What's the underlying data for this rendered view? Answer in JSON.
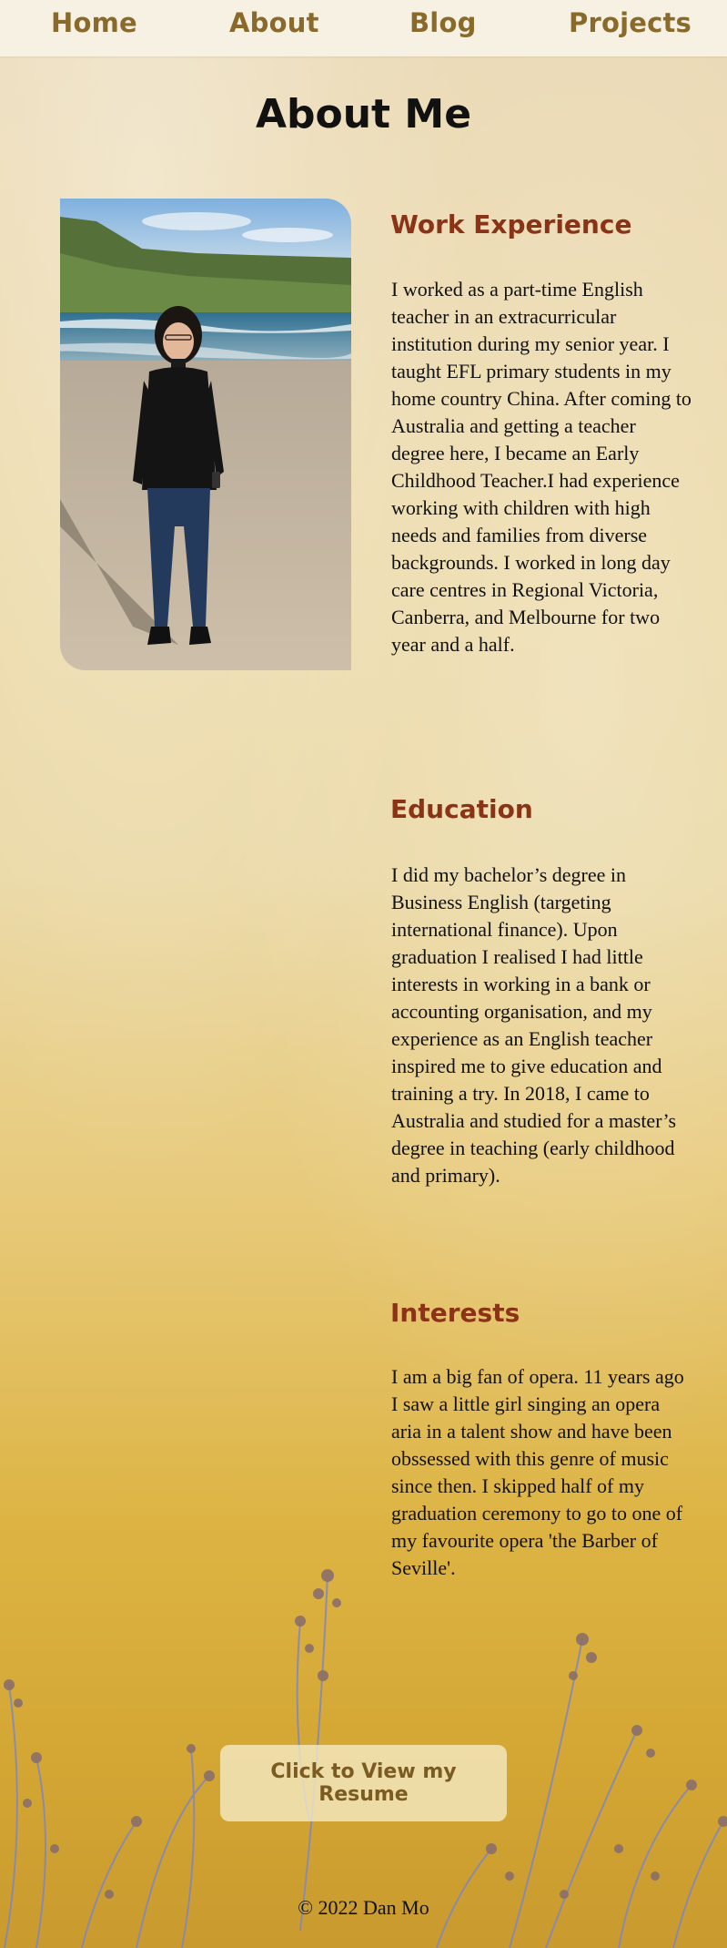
{
  "nav": {
    "home": "Home",
    "about": "About",
    "blog": "Blog",
    "projects": "Projects"
  },
  "page": {
    "title": "About Me"
  },
  "work": {
    "heading": "Work Experience",
    "body": "I worked as a part-time English teacher in an extracurricular institution during my senior year. I taught EFL primary students in my home country China. After coming to Australia and getting a teacher degree here, I became an Early Childhood Teacher.I had experience working with children with high needs and families from diverse backgrounds. I worked in long day care centres in Regional Victoria, Canberra, and Melbourne for two year and a half."
  },
  "education": {
    "heading": "Education",
    "body": "I did my bachelor’s degree in Business English (targeting international finance). Upon graduation I realised I had little interests in working in a bank or accounting organisation, and my experience as an English teacher inspired me to give education and training a try. In 2018, I came to Australia and studied for a master’s degree in teaching (early childhood and primary)."
  },
  "interests": {
    "heading": "Interests",
    "body": "I am a big fan of opera. 11 years ago I saw a little girl singing an opera aria in a talent show and have been obssessed with this genre of music since then. I skipped half of my graduation ceremony to go to one of my favourite opera 'the Barber of Seville'."
  },
  "resume": {
    "button_label": "Click to View my Resume"
  },
  "footer": {
    "text": "© 2022 Dan Mo"
  },
  "colors": {
    "nav_bg": "#f6f1e3",
    "nav_link": "#8a6a2b",
    "heading": "#8a3317",
    "title": "#111111"
  }
}
